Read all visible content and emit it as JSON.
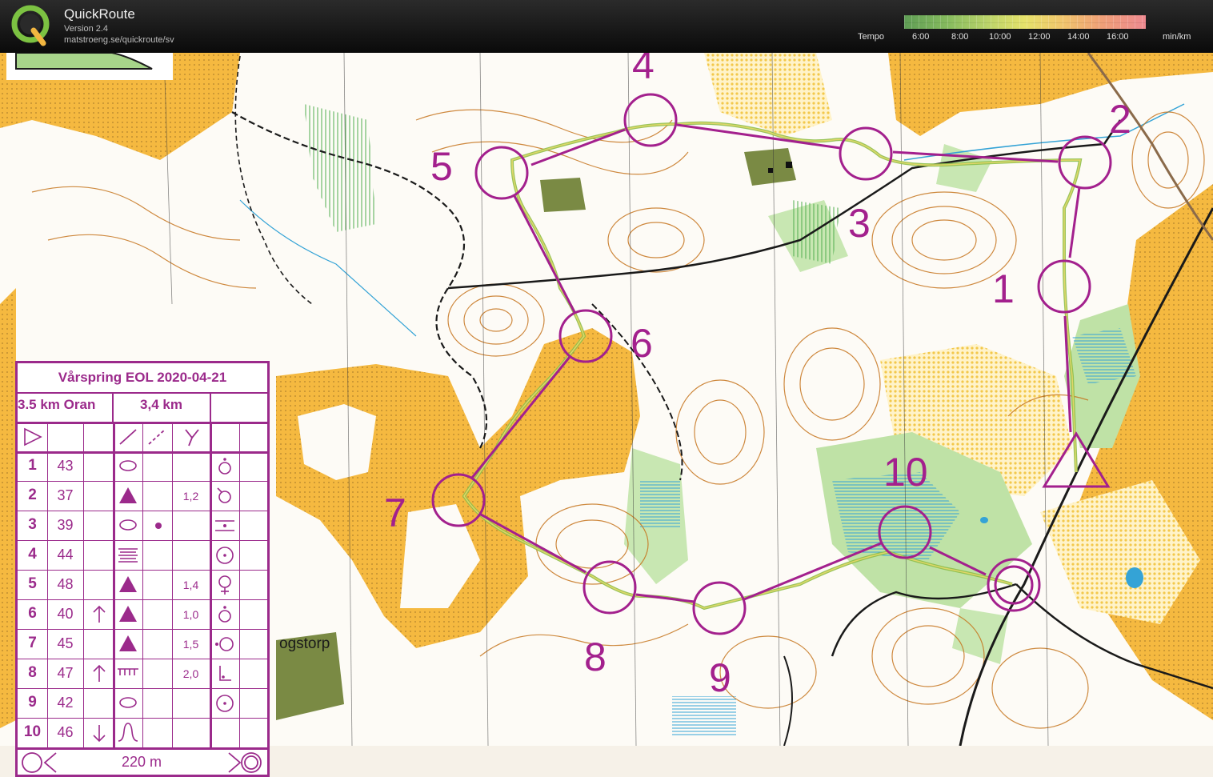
{
  "header": {
    "title": "QuickRoute",
    "version": "Version 2.4",
    "url": "matstroeng.se/quickroute/sv",
    "tempo_label": "Tempo",
    "tempo_ticks": [
      "6:00",
      "8:00",
      "10:00",
      "12:00",
      "14:00",
      "16:00"
    ],
    "tempo_unit": "min/km"
  },
  "map": {
    "control_numbers": [
      "1",
      "2",
      "3",
      "4",
      "5",
      "6",
      "7",
      "8",
      "9",
      "10"
    ],
    "place_name": "ogstorp"
  },
  "control_description": {
    "event_title": "Vårspring EOL 2020-04-21",
    "course": "3.5 km Oran",
    "length": "3,4 km",
    "rows": [
      {
        "number": "1",
        "code": "43",
        "feature": "knoll-oval",
        "dimension": "",
        "location": "top"
      },
      {
        "number": "2",
        "code": "37",
        "feature": "boulder",
        "dimension": "1,2",
        "location": "foot"
      },
      {
        "number": "3",
        "code": "39",
        "feature": "knoll-oval",
        "appearance": "dot",
        "dimension": "",
        "location": "between"
      },
      {
        "number": "4",
        "code": "44",
        "feature": "marsh",
        "dimension": "",
        "location": "centre"
      },
      {
        "number": "5",
        "code": "48",
        "feature": "boulder",
        "dimension": "1,4",
        "location": "bottom"
      },
      {
        "number": "6",
        "code": "40",
        "which": "north",
        "feature": "boulder",
        "dimension": "1,0",
        "location": "top"
      },
      {
        "number": "7",
        "code": "45",
        "feature": "boulder",
        "dimension": "1,5",
        "location": "west"
      },
      {
        "number": "8",
        "code": "47",
        "which": "north",
        "feature": "fence",
        "dimension": "2,0",
        "location": "corner"
      },
      {
        "number": "9",
        "code": "42",
        "feature": "knoll-oval",
        "dimension": "",
        "location": "centre"
      },
      {
        "number": "10",
        "code": "46",
        "which": "south",
        "feature": "re-entrant",
        "dimension": "",
        "location": ""
      }
    ],
    "finish_distance": "220 m"
  },
  "colors": {
    "course_purple": "#a3208d",
    "open_land": "#f5b940",
    "forest_white": "#ffffff",
    "green": "#b6dc9c",
    "water": "#34a3d6",
    "contour_brown": "#c6751e"
  }
}
